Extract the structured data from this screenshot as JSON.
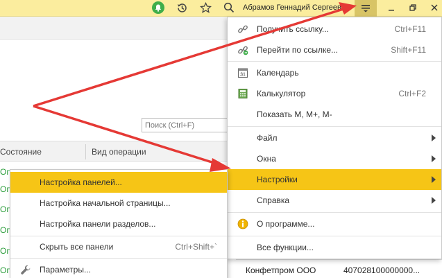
{
  "topbar": {
    "username": "Абрамов Геннадий Сергеевич",
    "icons": [
      "bell-icon",
      "history-icon",
      "star-icon",
      "search-icon",
      "hamburger-menu-icon",
      "minimize-icon",
      "restore-icon",
      "close-icon"
    ]
  },
  "search": {
    "placeholder": "Поиск (Ctrl+F)"
  },
  "grid": {
    "columns": [
      "Состояние",
      "Вид операции"
    ],
    "rows": [
      "Оп",
      "Оп",
      "Оп",
      "Оп",
      "Оп",
      "Оп"
    ]
  },
  "main_menu": {
    "items": [
      {
        "label": "Получить ссылку...",
        "shortcut": "Ctrl+F11",
        "icon": "link-icon"
      },
      {
        "label": "Перейти по ссылке...",
        "shortcut": "Shift+F11",
        "icon": "goto-link-icon"
      },
      {
        "label": "Календарь",
        "shortcut": "",
        "icon": "calendar-icon"
      },
      {
        "label": "Калькулятор",
        "shortcut": "Ctrl+F2",
        "icon": "calculator-icon"
      },
      {
        "label": "Показать М, М+, М-",
        "shortcut": ""
      },
      {
        "label": "Файл",
        "submenu": true
      },
      {
        "label": "Окна",
        "submenu": true
      },
      {
        "label": "Настройки",
        "submenu": true,
        "active": true
      },
      {
        "label": "Справка",
        "submenu": true
      },
      {
        "label": "О программе...",
        "icon": "info-icon"
      },
      {
        "label": "Все функции..."
      }
    ]
  },
  "sub_menu": {
    "items": [
      {
        "label": "Настройка панелей...",
        "active": true
      },
      {
        "label": "Настройка начальной страницы..."
      },
      {
        "label": "Настройка панели разделов..."
      },
      {
        "label": "Скрыть все панели",
        "shortcut": "Ctrl+Shift+`"
      },
      {
        "label": "Параметры...",
        "icon": "wrench-icon"
      }
    ]
  },
  "bottom_row": {
    "name": "Конфетпром ООО",
    "account": "407028100000000..."
  },
  "colors": {
    "topbar": "#fbed9e",
    "active": "#f6c516",
    "arrow": "#e53935"
  }
}
